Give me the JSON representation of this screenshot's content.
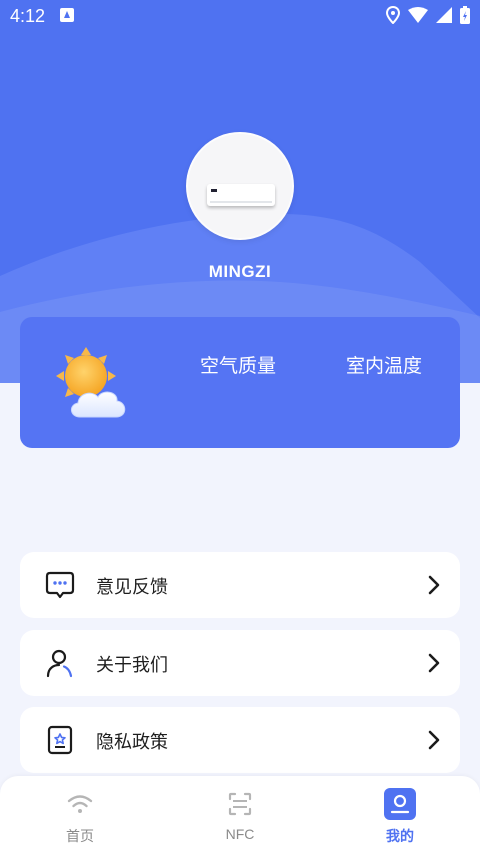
{
  "status_bar": {
    "time": "4:12"
  },
  "profile": {
    "name": "MINGZI"
  },
  "weather_card": {
    "air_quality_label": "空气质量",
    "indoor_temp_label": "室内温度"
  },
  "menu": {
    "items": [
      {
        "label": "意见反馈",
        "icon": "feedback-icon"
      },
      {
        "label": "关于我们",
        "icon": "user-icon"
      },
      {
        "label": "隐私政策",
        "icon": "privacy-icon"
      }
    ]
  },
  "tabbar": {
    "tabs": [
      {
        "label": "首页",
        "icon": "wifi-icon",
        "active": false
      },
      {
        "label": "NFC",
        "icon": "nfc-scan-icon",
        "active": false
      },
      {
        "label": "我的",
        "icon": "profile-icon",
        "active": true
      }
    ]
  },
  "colors": {
    "accent": "#4f72f1",
    "card": "#5574f3",
    "background": "#f2f4fd"
  }
}
